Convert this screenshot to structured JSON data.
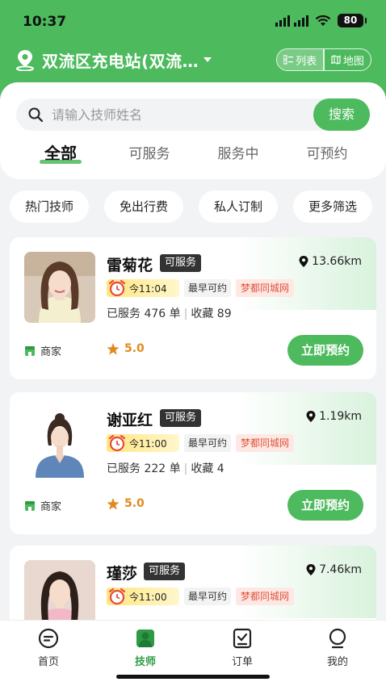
{
  "status_bar": {
    "time": "10:37",
    "battery": "80"
  },
  "header": {
    "location": "双流区充电站(双流…",
    "view_list": "列表",
    "view_map": "地图"
  },
  "search": {
    "placeholder": "请输入技师姓名",
    "button": "搜索"
  },
  "tabs": [
    "全部",
    "可服务",
    "服务中",
    "可预约"
  ],
  "filters": [
    "热门技师",
    "免出行费",
    "私人订制",
    "更多筛选"
  ],
  "technicians": [
    {
      "name": "雷菊花",
      "status": "可服务",
      "distance": "13.66km",
      "time": "今11:04",
      "earliest": "最早可约",
      "platform": "梦都同城网",
      "served": "已服务 476 单",
      "favorites": "收藏 89",
      "merchant": "商家",
      "rating": "5.0",
      "book": "立即预约"
    },
    {
      "name": "谢亚红",
      "status": "可服务",
      "distance": "1.19km",
      "time": "今11:00",
      "earliest": "最早可约",
      "platform": "梦都同城网",
      "served": "已服务 222 单",
      "favorites": "收藏 4",
      "merchant": "商家",
      "rating": "5.0",
      "book": "立即预约"
    },
    {
      "name": "瑾莎",
      "status": "可服务",
      "distance": "7.46km",
      "time": "今11:00",
      "earliest": "最早可约",
      "platform": "梦都同城网"
    }
  ],
  "nav": {
    "home": "首页",
    "technician": "技师",
    "orders": "订单",
    "mine": "我的"
  },
  "colors": {
    "brand": "#4cba5d",
    "rating": "#e08a1e",
    "tag_red": "#e0533d"
  }
}
